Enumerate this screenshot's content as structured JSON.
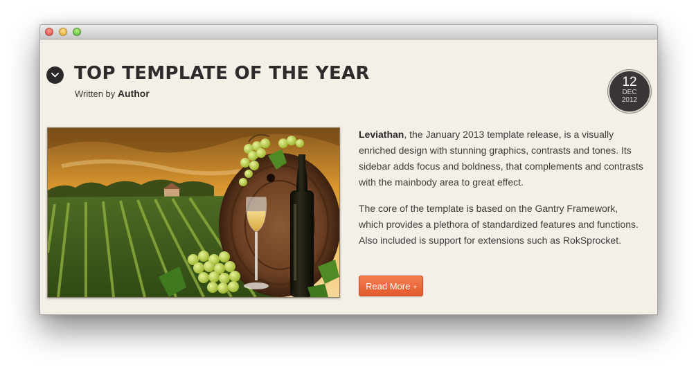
{
  "window": {
    "controls": [
      "close",
      "minimize",
      "zoom"
    ]
  },
  "article": {
    "title": "TOP TEMPLATE OF THE YEAR",
    "written_by_label": "Written by",
    "author": "Author",
    "date": {
      "day": "12",
      "month": "DEC",
      "year": "2012"
    },
    "image_subject": "vineyard-wine-bottle-barrel-grapes",
    "lead_name": "Leviathan",
    "paragraph1_rest": ", the January 2013 template release, is a visually enriched design with stunning graphics, contrasts and tones. Its sidebar adds focus and boldness, that complements and contrasts with the mainbody area to great effect.",
    "paragraph2": "The core of the template is based on the Gantry Framework, which provides a plethora of standardized features and functions. Also included is support for extensions such as RokSprocket.",
    "read_more_label": "Read More",
    "read_more_icon": "+"
  },
  "colors": {
    "page_background": "#f4f0e8",
    "accent_button": "#ec6a3d",
    "badge_background": "#3a3536",
    "title_text": "#2d2b2c"
  }
}
